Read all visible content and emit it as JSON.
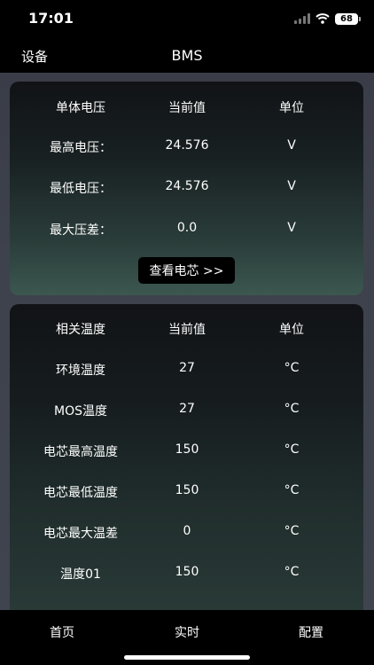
{
  "status_bar": {
    "time": "17:01",
    "battery": "68"
  },
  "nav": {
    "back_label": "设备",
    "title": "BMS"
  },
  "voltage": {
    "headers": [
      "单体电压",
      "当前值",
      "单位"
    ],
    "rows": [
      [
        "最高电压：",
        "24.576",
        "V"
      ],
      [
        "最低电压：",
        "24.576",
        "V"
      ],
      [
        "最大压差：",
        "0.0",
        "V"
      ]
    ],
    "button_label": "查看电芯 >>"
  },
  "temperature": {
    "headers": [
      "相关温度",
      "当前值",
      "单位"
    ],
    "rows": [
      [
        "环境温度",
        "27",
        "°C"
      ],
      [
        "MOS温度",
        "27",
        "°C"
      ],
      [
        "电芯最高温度",
        "150",
        "°C"
      ],
      [
        "电芯最低温度",
        "150",
        "°C"
      ],
      [
        "电芯最大温差",
        "0",
        "°C"
      ],
      [
        "温度01",
        "150",
        "°C"
      ]
    ]
  },
  "tabs": [
    "首页",
    "实时",
    "配置"
  ]
}
